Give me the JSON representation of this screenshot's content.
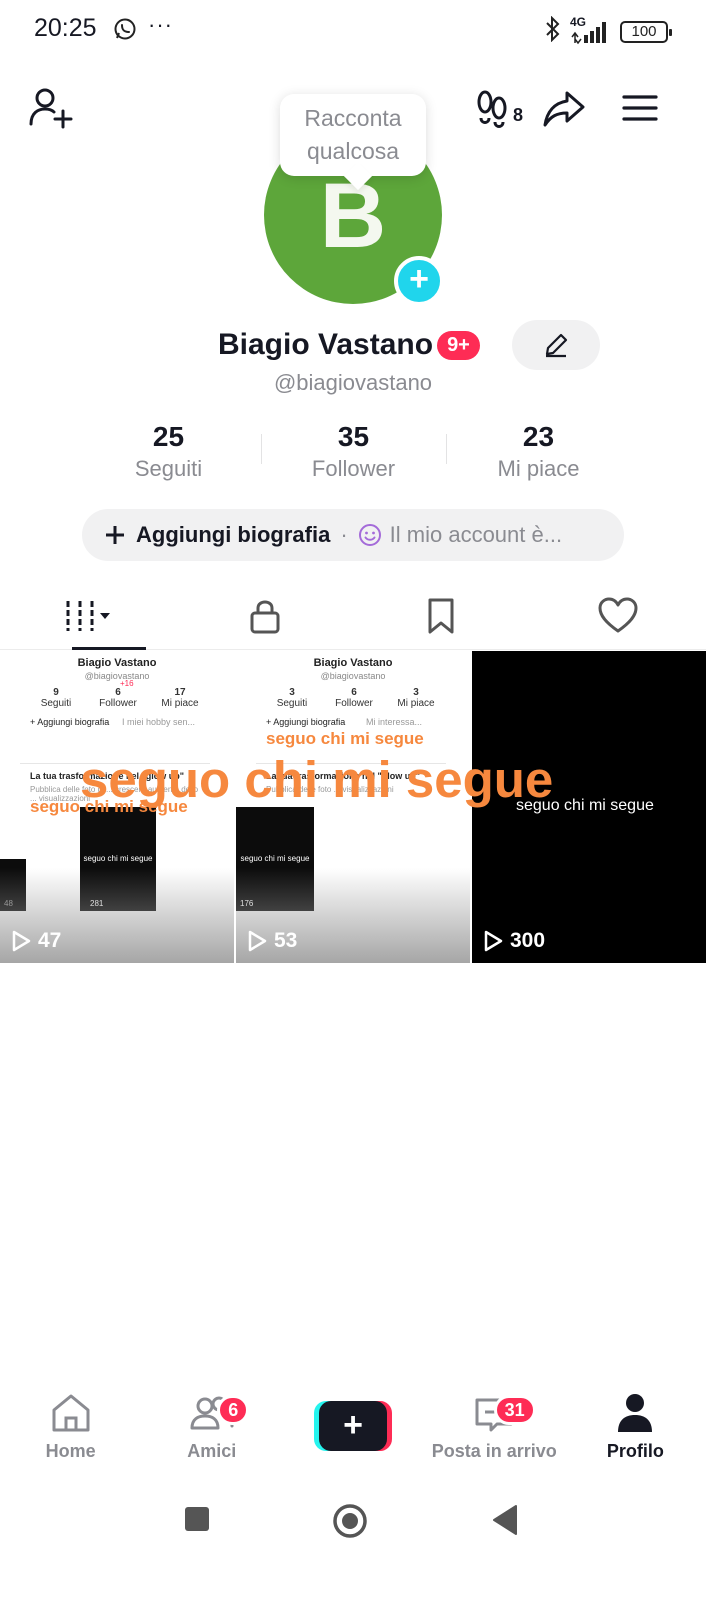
{
  "status_bar": {
    "time": "20:25",
    "dots": "···",
    "network": "4G",
    "battery": "100"
  },
  "header": {
    "tooltip": "Racconta qualcosa",
    "follow_requests_count": "8",
    "avatar_letter": "B"
  },
  "profile": {
    "name": "Biagio Vastano",
    "name_badge": "9+",
    "handle": "@biagiovastano",
    "stats": [
      {
        "value": "25",
        "label": "Seguiti"
      },
      {
        "value": "35",
        "label": "Follower"
      },
      {
        "value": "23",
        "label": "Mi piace"
      }
    ],
    "bio_add": "Aggiungi biografia",
    "bio_separator": "·",
    "bio_account": "Il mio account è..."
  },
  "tabs": [
    "videos",
    "private",
    "saved",
    "liked"
  ],
  "videos": [
    {
      "views": "47",
      "mini_name": "Biagio Vastano",
      "mini_handle": "@biagiovastano",
      "mini_stats": [
        [
          "9",
          "Seguiti"
        ],
        [
          "6",
          "Follower"
        ],
        [
          "17",
          "Mi piace"
        ]
      ],
      "mini_delta": "+16",
      "mini_bio": "+ Aggiungi biografia",
      "mini_interest": "I miei hobby sen...",
      "mini_post": "La tua trasformazione nel \"glow up\"",
      "mini_post_sub": "Pubblica delle foto di ... crescere aumento dello ... visualizzazioni",
      "mini_views": [
        "48",
        "281"
      ],
      "overlay_small": "seguo chi mi segue",
      "mini_black_caption": "seguo chi mi segue"
    },
    {
      "views": "53",
      "mini_name": "Biagio Vastano",
      "mini_handle": "@biagiovastano",
      "mini_stats": [
        [
          "3",
          "Seguiti"
        ],
        [
          "6",
          "Follower"
        ],
        [
          "3",
          "Mi piace"
        ]
      ],
      "mini_bio": "+ Aggiungi biografia",
      "mini_interest": "Mi interessa...",
      "mini_post": "La tua trasformazione nel \"glow up\"",
      "mini_post_sub": "Pubblica delle foto ... visualizzazioni",
      "mini_views": [
        "176"
      ],
      "overlay_small": "seguo chi mi segue",
      "mini_black_caption": "seguo chi mi segue"
    },
    {
      "views": "300",
      "caption": "seguo chi mi segue"
    }
  ],
  "big_overlay": "seguo chi mi segue",
  "bottom_nav": [
    {
      "label": "Home"
    },
    {
      "label": "Amici",
      "badge": "6"
    },
    {
      "label": ""
    },
    {
      "label": "Posta in arrivo",
      "badge": "31"
    },
    {
      "label": "Profilo"
    }
  ],
  "colors": {
    "accent_red": "#fe2c55",
    "accent_cyan": "#20d5ec",
    "avatar_green": "#5da63a",
    "overlay_orange": "#f6883e"
  }
}
